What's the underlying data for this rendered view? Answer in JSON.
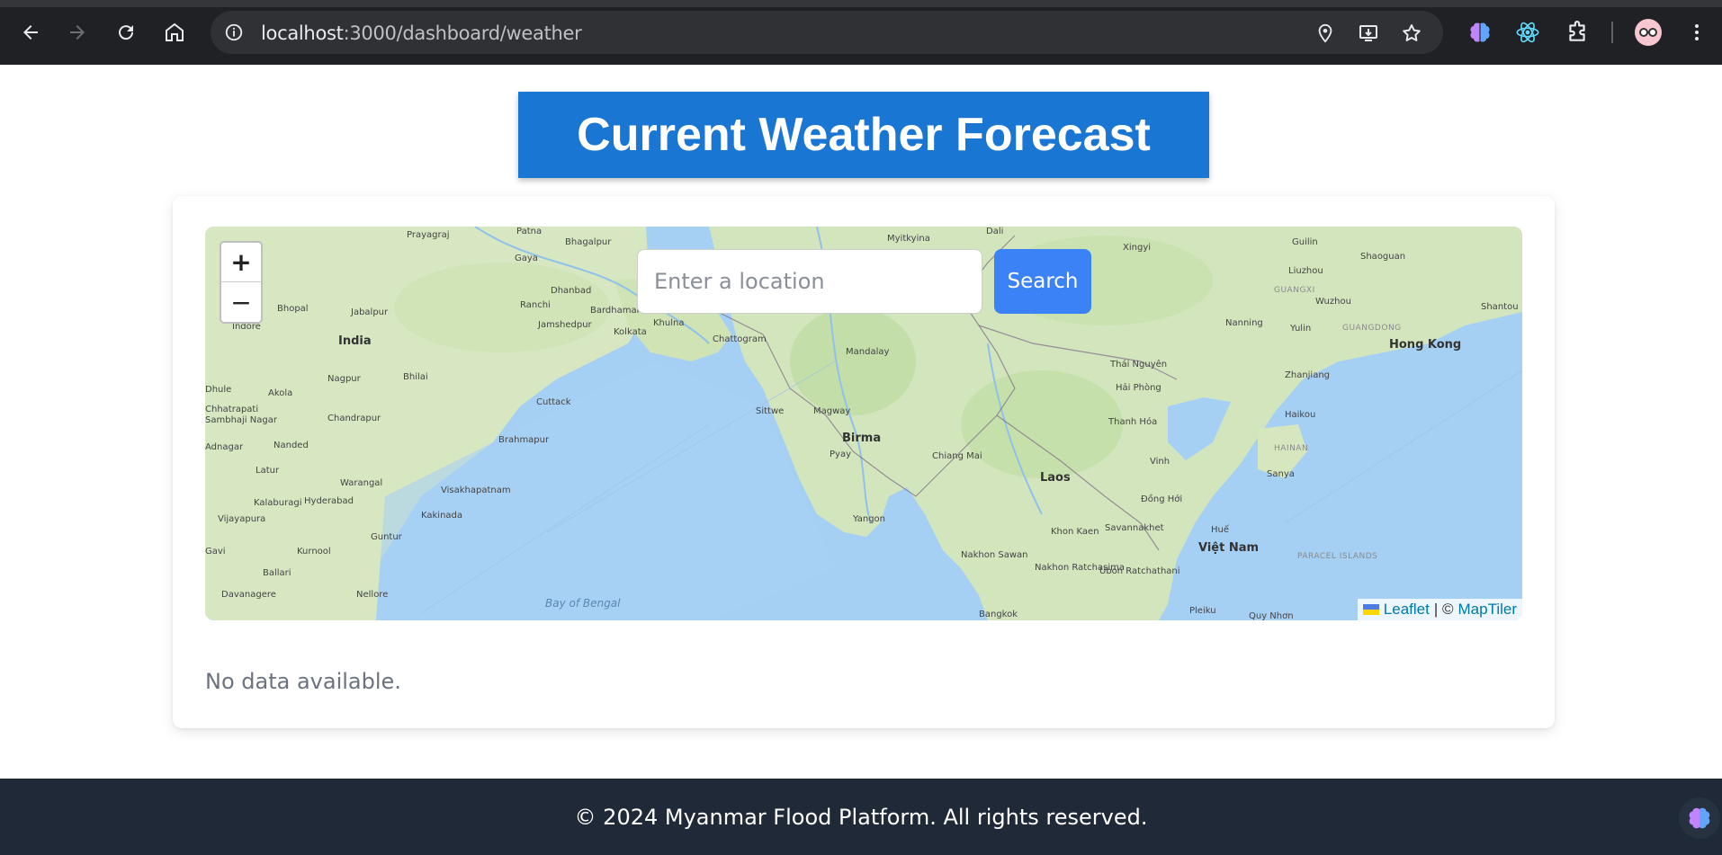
{
  "browser": {
    "url_host": "localhost",
    "url_path": ":3000/dashboard/weather",
    "icons": [
      "back-arrow-icon",
      "forward-arrow-icon",
      "reload-icon",
      "home-icon",
      "site-info-icon",
      "location-pin-icon",
      "install-app-icon",
      "bookmark-star-icon",
      "brain-extension-icon",
      "react-extension-icon",
      "puzzle-extensions-icon",
      "profile-avatar-icon",
      "more-menu-icon"
    ]
  },
  "header": {
    "title": "Current Weather Forecast",
    "accent": "#1976d2"
  },
  "map": {
    "search_placeholder": "Enter a location",
    "search_value": "",
    "search_button": "Search",
    "zoom_in": "+",
    "zoom_out": "−",
    "attribution_leaflet": "Leaflet",
    "attribution_sep": "| ©",
    "attribution_maptiler": "MapTiler",
    "places": [
      "Prayagraj",
      "Patna",
      "Bhagalpur",
      "Gaya",
      "Dhanbad",
      "Ranchi",
      "Bardhaman",
      "Jamshedpur",
      "Kolkata",
      "Khulna",
      "Chattogram",
      "Bhopal",
      "Jabalpur",
      "Indore",
      "India",
      "Nagpur",
      "Bhilai",
      "Akola",
      "Chhatrapati",
      "Sambhaji Nagar",
      "Chandrapur",
      "Cuttack",
      "Brahmapur",
      "Nanded",
      "Latur",
      "Warangal",
      "Kalaburagi",
      "Hyderabad",
      "Visakhapatnam",
      "Vijayapura",
      "Kakinada",
      "Guntur",
      "Kurnool",
      "Ballari",
      "Davanagere",
      "Nellore",
      "Bay of Bengal",
      "Myitkyina",
      "Dali",
      "Xingyi",
      "Guilin",
      "Shaoguan",
      "Liuzhou",
      "GUANGXI",
      "Wuzhou",
      "Shantou",
      "Nanning",
      "Yulin",
      "GUANGDONG",
      "Hong Kong",
      "Mandalay",
      "Thái Nguyên",
      "Hải Phòng",
      "Zhanjiang",
      "Sittwe",
      "Magway",
      "Thanh Hóa",
      "Haikou",
      "Birma",
      "Pyay",
      "Chiang Mai",
      "HAINAN",
      "Vinh",
      "Laos",
      "Sanya",
      "Đồng Hới",
      "Yangon",
      "Huế",
      "Khon Kaen",
      "Savannakhet",
      "Việt Nam",
      "Nakhon Sawan",
      "Nakhon Ratchasima",
      "Ubon Ratchathani",
      "PARACEL ISLANDS",
      "Bangkok",
      "Pleiku",
      "Quy Nhơn",
      "Dhule",
      "Adnagar",
      "Gavi"
    ]
  },
  "content": {
    "no_data": "No data available."
  },
  "footer": {
    "text": "© 2024 Myanmar Flood Platform. All rights reserved."
  }
}
